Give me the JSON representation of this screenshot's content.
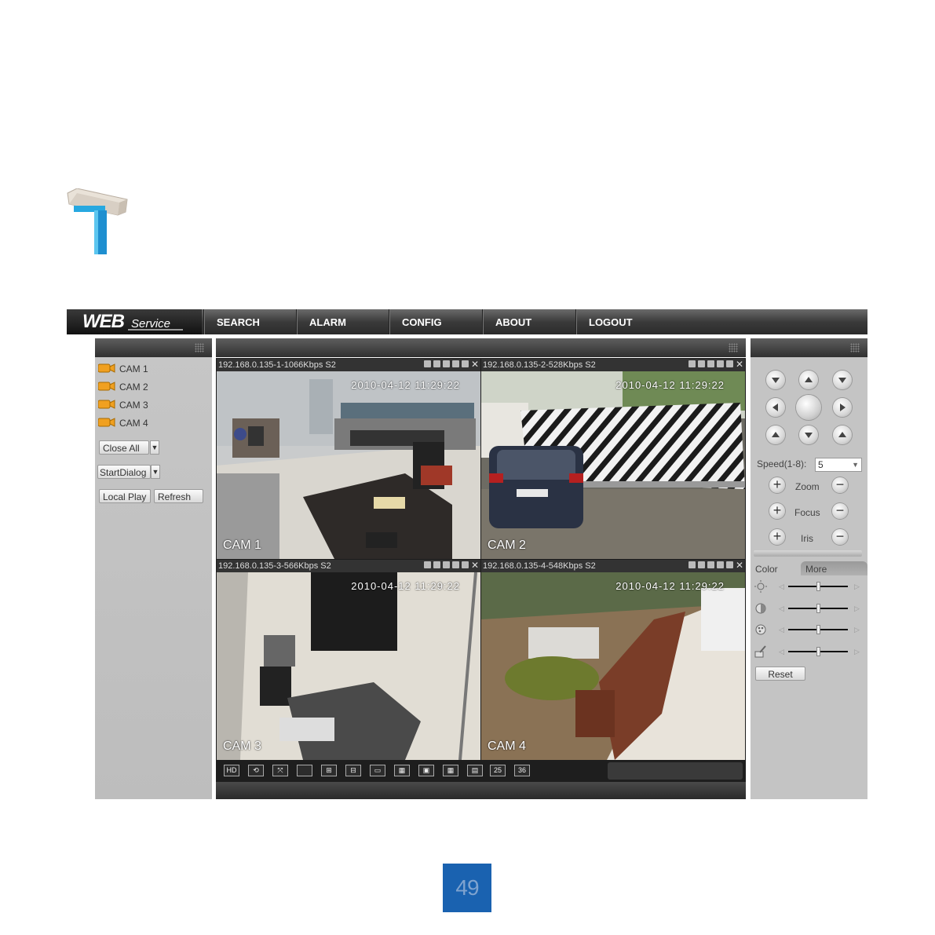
{
  "brand": {
    "web": "WEB",
    "service": "Service"
  },
  "nav": [
    "SEARCH",
    "ALARM",
    "CONFIG",
    "ABOUT",
    "LOGOUT"
  ],
  "left_panel": {
    "cameras": [
      "CAM 1",
      "CAM 2",
      "CAM 3",
      "CAM 4"
    ],
    "close_all": "Close All",
    "start_dialog": "StartDialog",
    "local_play": "Local Play",
    "refresh": "Refresh"
  },
  "tiles": [
    {
      "title": "192.168.0.135-1-1066Kbps S2",
      "cam": "CAM 1",
      "timestamp": "2010-04-12 11:29:22"
    },
    {
      "title": "192.168.0.135-2-528Kbps S2",
      "cam": "CAM 2",
      "timestamp": "2010-04-12 11:29:22"
    },
    {
      "title": "192.168.0.135-3-566Kbps S2",
      "cam": "CAM 3",
      "timestamp": "2010-04-12 11:29:22"
    },
    {
      "title": "192.168.0.135-4-548Kbps S2",
      "cam": "CAM 4",
      "timestamp": "2010-04-12 11:29:22"
    }
  ],
  "layout_buttons": [
    "25",
    "36"
  ],
  "ptz": {
    "speed_label": "Speed(1-8):",
    "speed_value": "5",
    "zoom": "Zoom",
    "focus": "Focus",
    "iris": "Iris"
  },
  "color": {
    "tab_color": "Color",
    "tab_more": "More",
    "reset": "Reset",
    "sliders": [
      "brightness-icon",
      "contrast-icon",
      "saturation-icon",
      "hue-icon"
    ]
  },
  "page_number": "49",
  "colors": {
    "accent_green": "#46d246",
    "page_badge": "#1a62b0",
    "nav_dark": "#2b2b2b"
  }
}
